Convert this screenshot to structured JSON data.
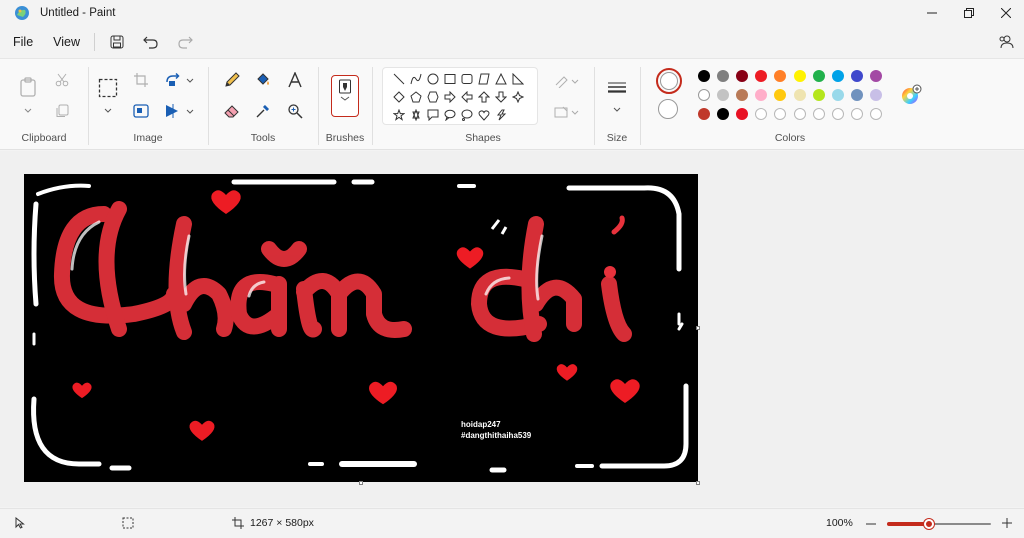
{
  "window": {
    "title": "Untitled - Paint",
    "icon": "paint-app-icon",
    "controls": [
      "minimize-icon",
      "restore-icon",
      "close-icon"
    ]
  },
  "menu": {
    "file_label": "File",
    "view_label": "View",
    "quick_actions": [
      "save-icon",
      "undo-icon",
      "redo-icon"
    ]
  },
  "ribbon": {
    "groups": {
      "clipboard": "Clipboard",
      "image": "Image",
      "tools": "Tools",
      "brushes": "Brushes",
      "shapes": "Shapes",
      "size": "Size",
      "colors": "Colors"
    },
    "primary_color": "#ffffff",
    "secondary_color": "#ffffff",
    "palette": [
      [
        "#000000",
        "#7f7f7f",
        "#880015",
        "#ed1c24",
        "#ff7f27",
        "#fff200",
        "#22b14c",
        "#00a2e8",
        "#3f48cc",
        "#a349a4"
      ],
      [
        "#ffffff",
        "#c3c3c3",
        "#b97a57",
        "#ffaec9",
        "#ffc90e",
        "#efe4b0",
        "#b5e61d",
        "#99d9ea",
        "#7092be",
        "#c8bfe7"
      ],
      [
        "#c0392b",
        "#000000",
        "#e81123",
        "",
        "",
        "",
        "",
        "",
        "",
        ""
      ]
    ]
  },
  "canvas": {
    "artwork_text": "Chăm chỉ",
    "watermark_line1": "hoidap247",
    "watermark_line2": "#dangthithaiha539",
    "accent_color": "#e8323c"
  },
  "status": {
    "canvas_size": "1267 × 580px",
    "zoom_label": "100%",
    "zoom_level": 0.5
  }
}
